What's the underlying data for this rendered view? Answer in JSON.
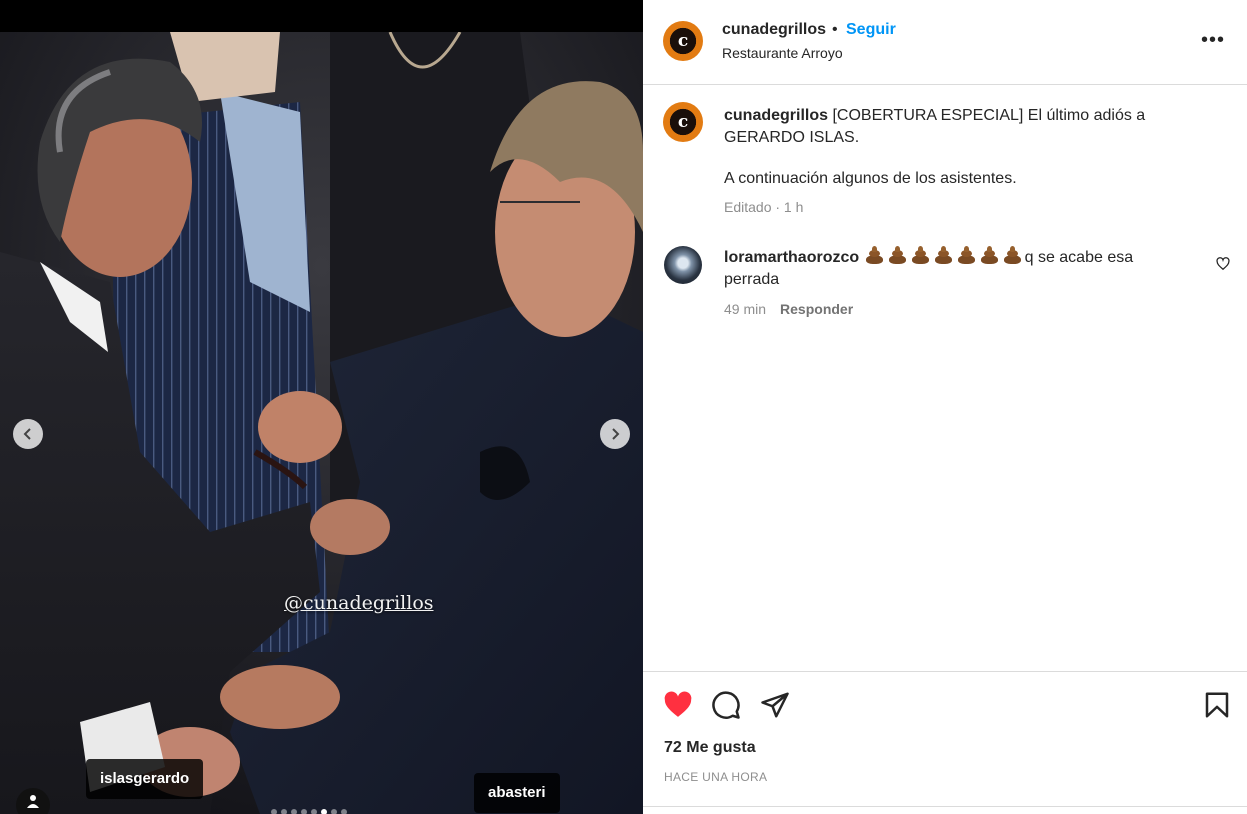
{
  "post": {
    "username": "cunadegrillos",
    "follow_label": "Seguir",
    "separator": "•",
    "location": "Restaurante Arroyo",
    "avatar_letter": "c",
    "more_label": "•••"
  },
  "media": {
    "watermark": "@cunadegrillos",
    "tags": [
      "islasgerardo",
      "abasteri"
    ],
    "prev_glyph": "‹",
    "next_glyph": "›",
    "carousel_dots": 8,
    "active_dot": 6
  },
  "caption": {
    "username": "cunadegrillos",
    "text_line1": "[COBERTURA ESPECIAL] El último adiós a GERARDO ISLAS.",
    "text_line2": "A continuación algunos de los asistentes.",
    "meta": "Editado · 1 h"
  },
  "comment": {
    "username": "loramarthaorozco",
    "emoji_count": 7,
    "text": "q se acabe esa perrada",
    "time": "49 min",
    "reply_label": "Responder"
  },
  "actions": {
    "likes": "72 Me gusta",
    "timestamp": "HACE UNA HORA"
  },
  "colors": {
    "accent": "#0095f6",
    "heart": "#ff3040",
    "avatar_orange": "#e27b12"
  },
  "icons": {
    "like": "heart-filled-icon",
    "comment": "comment-bubble-icon",
    "share": "paper-plane-icon",
    "save": "bookmark-icon",
    "more": "more-horizontal-icon"
  }
}
